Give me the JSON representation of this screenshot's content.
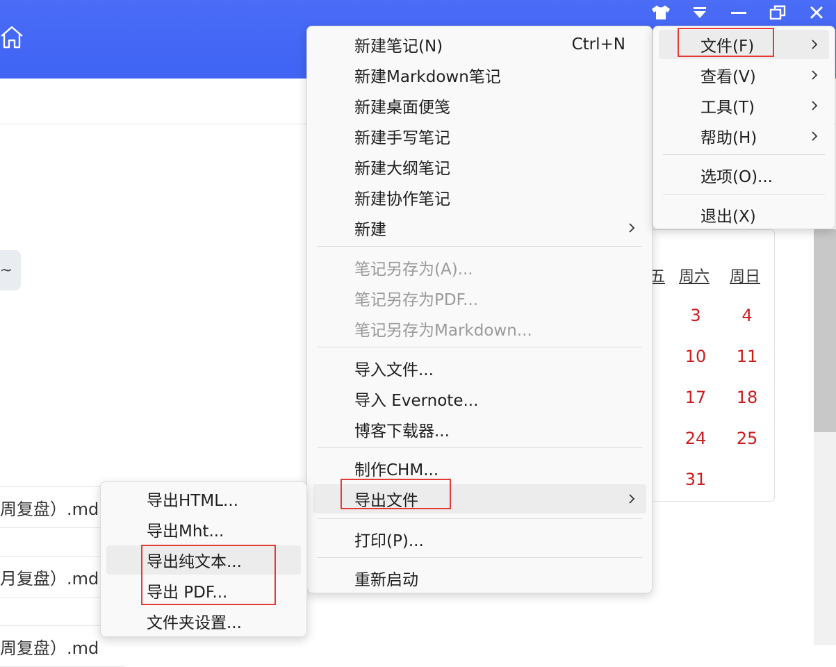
{
  "colors": {
    "header_bg": "#4366f5",
    "highlight_box": "#e53935",
    "calendar_weekend": "#cc1d1d",
    "disabled_text": "#9a9a9a"
  },
  "background": {
    "tilde": "~",
    "file_rows": [
      "周复盘）.md",
      "月复盘）.md",
      "周复盘）.md"
    ],
    "calendar": {
      "headers": [
        "五",
        "周六",
        "周日"
      ],
      "rows": [
        {
          "sat": "3",
          "sun": "4"
        },
        {
          "sat": "10",
          "sun": "11"
        },
        {
          "sat": "17",
          "sun": "18"
        },
        {
          "sat": "24",
          "sun": "25"
        },
        {
          "sat": "31",
          "sun": ""
        }
      ]
    }
  },
  "main_menu": {
    "items": [
      {
        "label": "文件(F)"
      },
      {
        "label": "查看(V)"
      },
      {
        "label": "工具(T)"
      },
      {
        "label": "帮助(H)"
      },
      {
        "label": "选项(O)..."
      },
      {
        "label": "退出(X)"
      }
    ]
  },
  "file_menu": {
    "items": [
      {
        "label": "新建笔记(N)",
        "shortcut": "Ctrl+N"
      },
      {
        "label": "新建Markdown笔记"
      },
      {
        "label": "新建桌面便笺"
      },
      {
        "label": "新建手写笔记"
      },
      {
        "label": "新建大纲笔记"
      },
      {
        "label": "新建协作笔记"
      },
      {
        "label": "新建"
      },
      {
        "label": "笔记另存为(A)..."
      },
      {
        "label": "笔记另存为PDF..."
      },
      {
        "label": "笔记另存为Markdown..."
      },
      {
        "label": "导入文件..."
      },
      {
        "label": "导入 Evernote..."
      },
      {
        "label": "博客下载器..."
      },
      {
        "label": "制作CHM..."
      },
      {
        "label": "导出文件"
      },
      {
        "label": "打印(P)..."
      },
      {
        "label": "重新启动"
      }
    ]
  },
  "export_menu": {
    "items": [
      {
        "label": "导出HTML..."
      },
      {
        "label": "导出Mht..."
      },
      {
        "label": "导出纯文本..."
      },
      {
        "label": "导出 PDF..."
      },
      {
        "label": "文件夹设置..."
      }
    ]
  }
}
